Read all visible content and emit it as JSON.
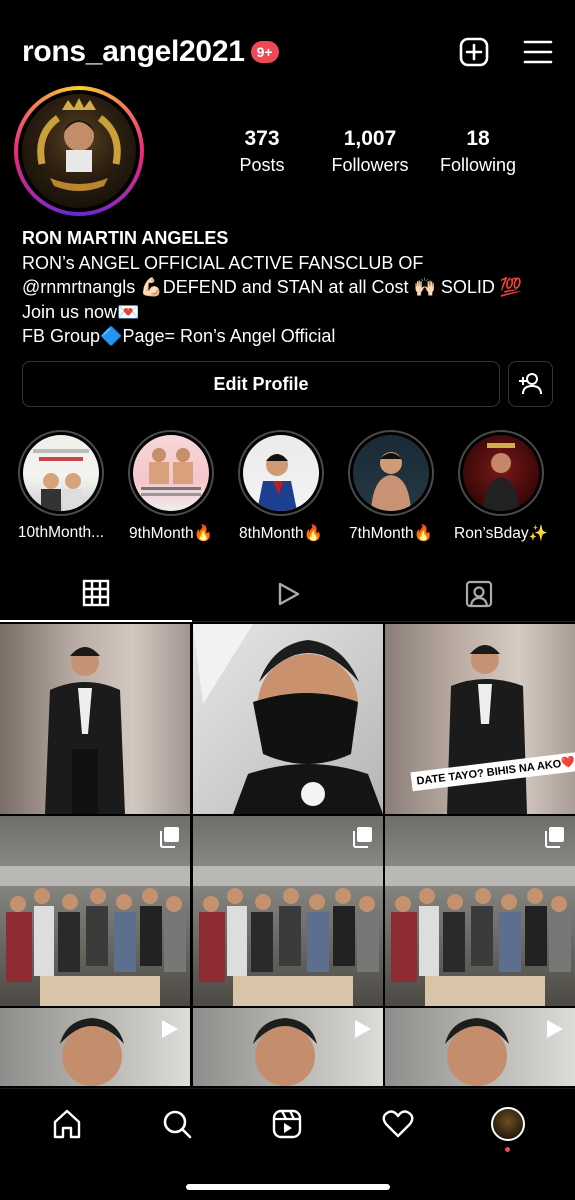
{
  "header": {
    "username": "rons_angel2021",
    "notification_badge": "9+",
    "icons": [
      "plus-square-icon",
      "menu-icon"
    ]
  },
  "profile": {
    "stats": [
      {
        "value": "373",
        "label": "Posts"
      },
      {
        "value": "1,007",
        "label": "Followers"
      },
      {
        "value": "18",
        "label": "Following"
      }
    ]
  },
  "bio": {
    "name": "RON MARTIN ANGELES",
    "line1": "RON’s ANGEL OFFICIAL ACTIVE FANSCLUB OF",
    "line2": "@rnmrtnangls 💪🏻DEFEND and STAN at all Cost 🙌🏻 SOLID 💯",
    "line3": "Join us now💌",
    "line4": "FB Group🔷Page= Ron’s Angel Official"
  },
  "buttons": {
    "edit_profile": "Edit Profile"
  },
  "highlights": [
    {
      "label": "10thMonth..."
    },
    {
      "label": "9thMonth🔥"
    },
    {
      "label": "8thMonth🔥"
    },
    {
      "label": "7thMonth🔥"
    },
    {
      "label": "Ron’sBday✨"
    }
  ],
  "tabs": [
    "grid-icon",
    "reels-icon",
    "tagged-icon"
  ],
  "posts": {
    "sticker_text": "DATE TAYO? BIHIS NA AKO❤️"
  },
  "colors": {
    "background": "#000000",
    "badge": "#ed4956",
    "border": "#363636"
  }
}
